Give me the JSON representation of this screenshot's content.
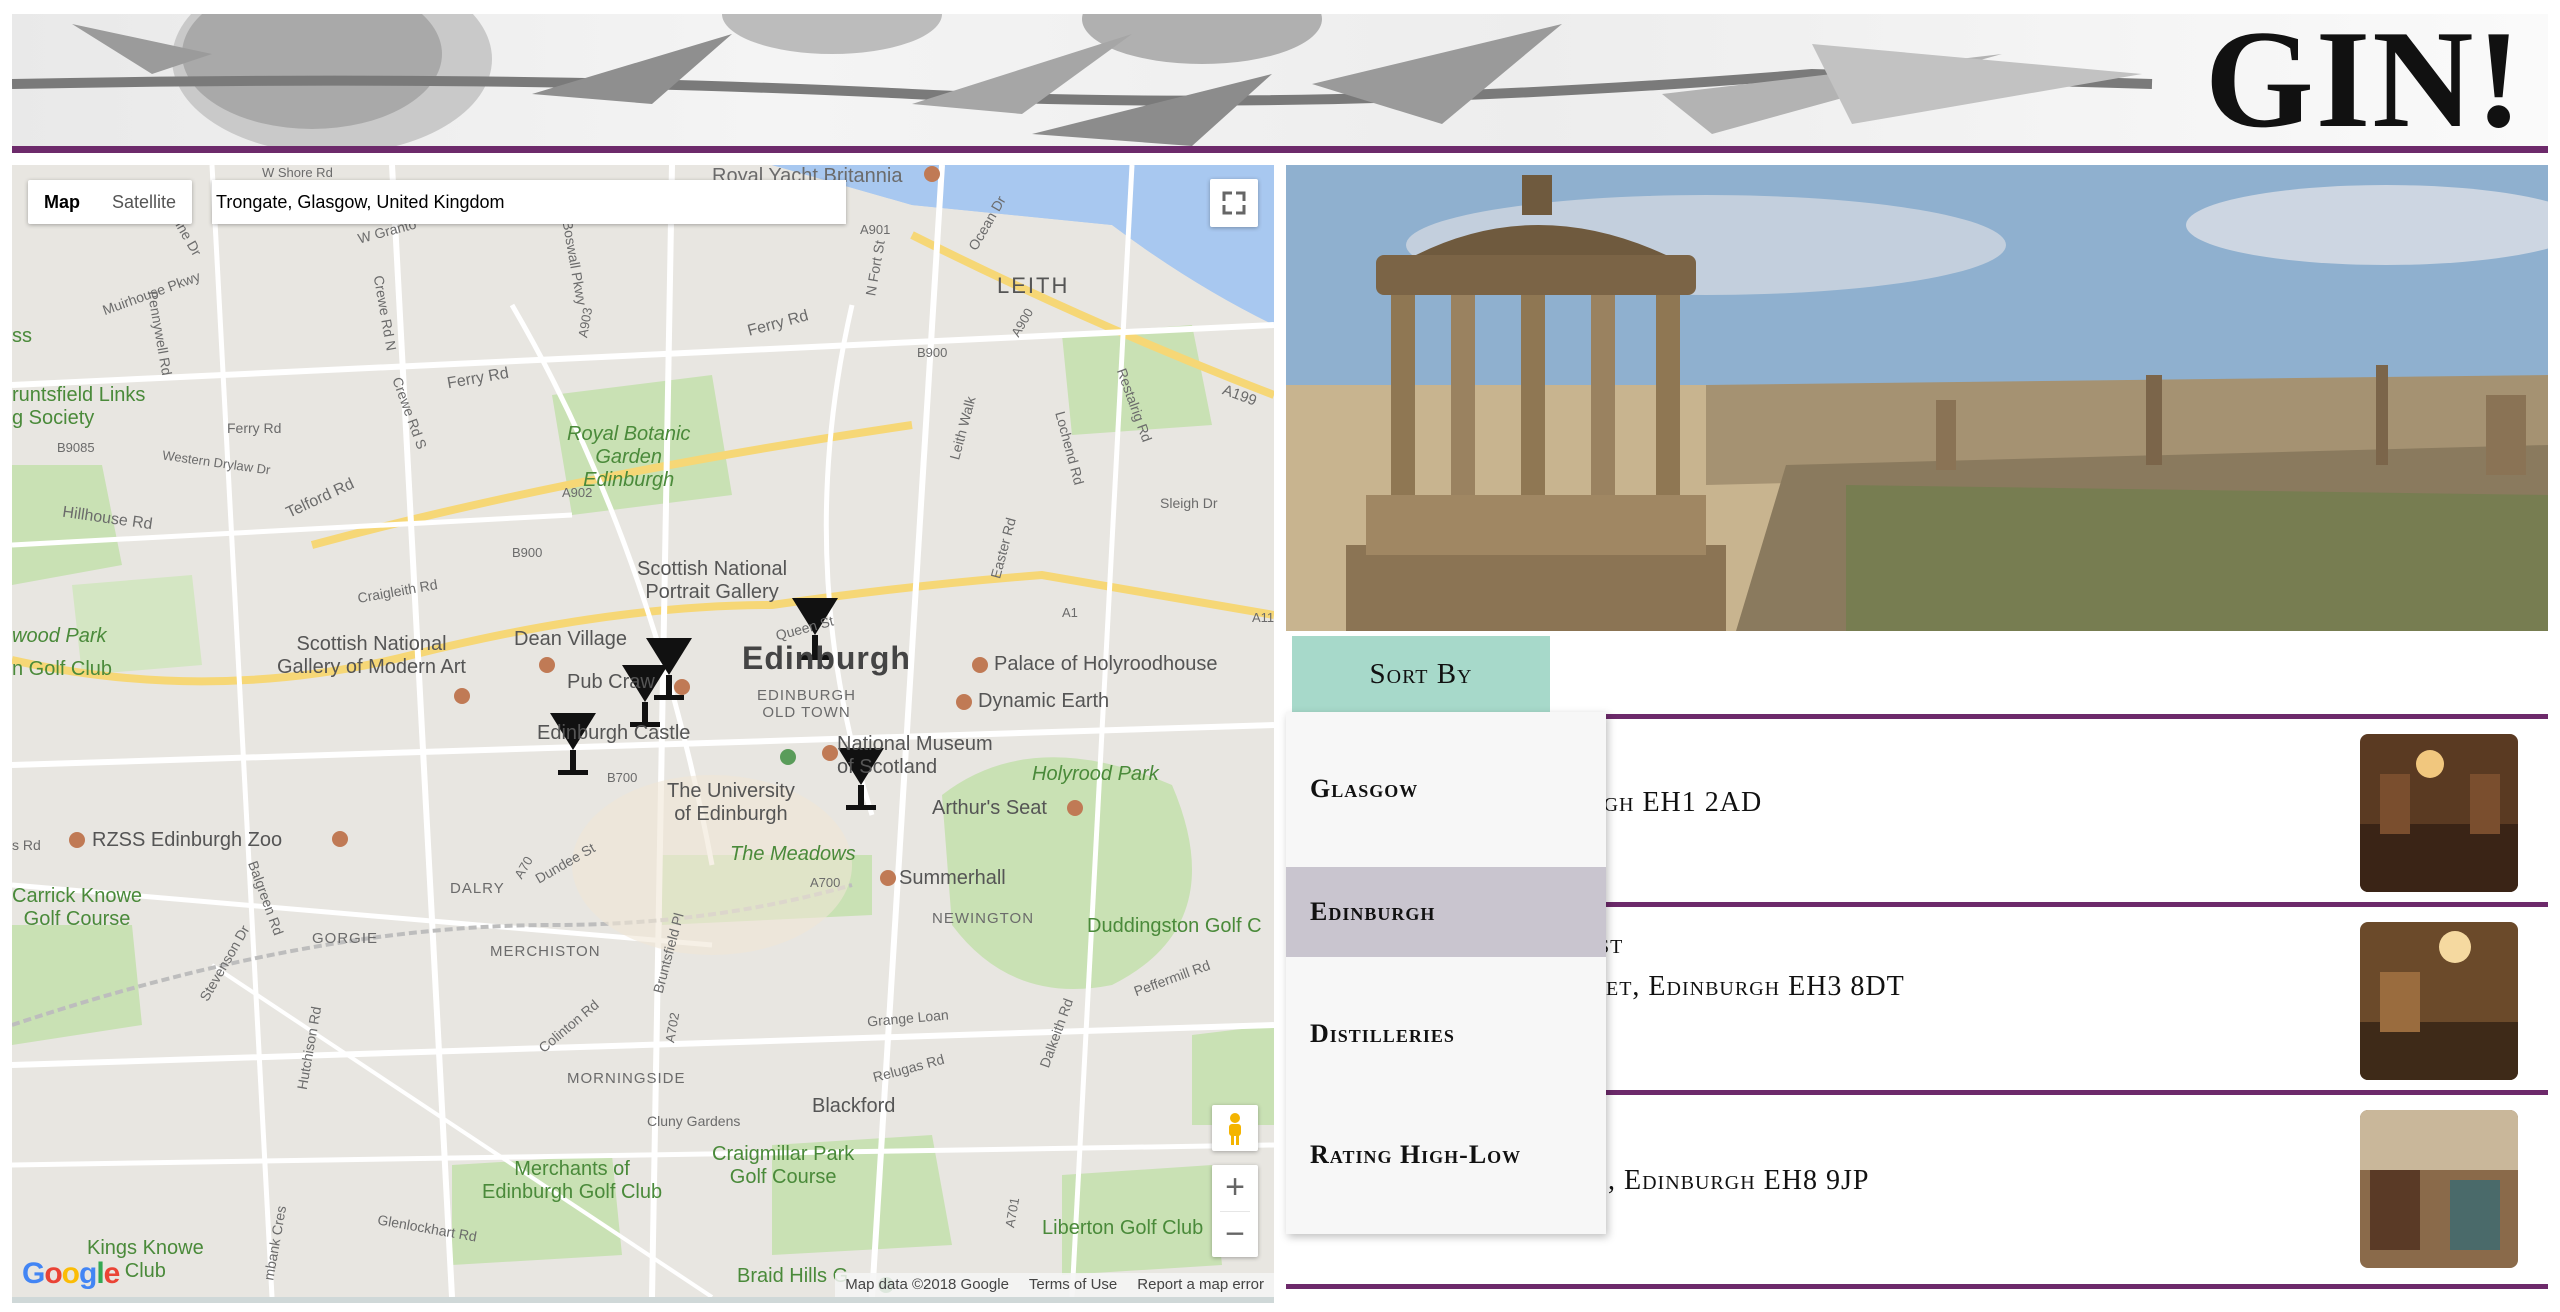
{
  "header": {
    "title": "GIN!"
  },
  "map": {
    "type_control": {
      "map_label": "Map",
      "satellite_label": "Satellite"
    },
    "search": {
      "value": "Trongate, Glasgow, United Kingdom"
    },
    "footer": {
      "attribution": "Map data ©2018 Google",
      "terms": "Terms of Use",
      "report": "Report a map error"
    },
    "logo": "Google",
    "zoom_in": "+",
    "zoom_out": "−",
    "labels": {
      "royal_yacht": "Royal Yacht Britannia",
      "w_shore": "W Shore Rd",
      "leith": "LEITH",
      "ferry_rd_1": "Ferry Rd",
      "ferry_rd_2": "Ferry Rd",
      "ferry_rd_3": "Ferry Rd",
      "telford": "Telford Rd",
      "hillhouse": "Hillhouse Rd",
      "royal_botanic": "Royal Botanic\nGarden\nEdinburgh",
      "fettes": "runtsfield Links\ng Society",
      "b9085": "B9085",
      "western": "Western Drylaw Dr",
      "scot_portrait": "Scottish National\nPortrait Gallery",
      "scot_modern": "Scottish National\nGallery of Modern Art",
      "dean": "Dean Village",
      "edinburgh": "Edinburgh",
      "pub_crawl": "Pub Craw",
      "edinburgh_castle": "Edinburgh Castle",
      "old_town": "EDINBURGH\nOLD TOWN",
      "palace": "Palace of Holyroodhouse",
      "dynamic": "Dynamic Earth",
      "museum": "National Museum\nof Scotland",
      "holyrood": "Holyrood Park",
      "arthurs": "Arthur's Seat",
      "university": "The University\nof Edinburgh",
      "meadows": "The Meadows",
      "summerhall": "Summerhall",
      "newington": "NEWINGTON",
      "zoo": "RZSS Edinburgh Zoo",
      "carrick": "Carrick Knowe\nGolf Course",
      "dalry": "DALRY",
      "gorgie": "GORGIE",
      "merchiston": "MERCHISTON",
      "duddingston": "Duddingston Golf C",
      "morningside": "MORNINGSIDE",
      "blackford": "Blackford",
      "craigmillar": "Craigmillar Park\nGolf Course",
      "merchants": "Merchants of\nEdinburgh Golf Club",
      "liberton": "Liberton Golf Club",
      "kings": "Kings Knowe\nClub",
      "braid": "Braid Hills G",
      "woodpark": "wood Park",
      "golfclub": "n Golf Club",
      "craigleith": "Craigleith Rd",
      "b900": "B900",
      "b700": "B700",
      "a700": "A700",
      "a70": "A70",
      "a1": "A1",
      "a199": "A199",
      "a901": "A901",
      "a902": "A902",
      "a903": "A903",
      "b901": "B900",
      "a900": "A900",
      "queen_st": "Queen St",
      "leith_walk": "Leith Walk",
      "lochend": "Lochend Rd",
      "restalrig": "Restalrig Rd",
      "easter": "Easter Rd",
      "sleigh": "Sleigh Dr",
      "dalkeith": "Dalkeith Rd",
      "pefermill": "Peffermill Rd",
      "grange": "Grange Loan",
      "relugas": "Relugas Rd",
      "colinton": "Colinton Rd",
      "glenlockhart": "Glenlockhart Rd",
      "balgreen": "Balgreen Rd",
      "stevenson": "Stevenson Dr",
      "dundee": "Dundee St",
      "bruntsfield": "Bruntsfield Pl",
      "hutchison": "Hutchison Rd",
      "cluny": "Cluny Gardens",
      "muirhouse": "Muirhouse Pkwy",
      "pennywell": "Pennywell Rd",
      "crewe_n": "Crewe Rd N",
      "crewe_s": "Crewe Rd S",
      "w_granton": "W Granto",
      "boswall": "Boswall Pkwy",
      "ocean": "Ocean Dr",
      "n_fort": "N Fort St",
      "a1140": "A11",
      "marine": "Marine Dr",
      "a702": "A702",
      "a701": "A701",
      "ss": "ss",
      "rd": "s Rd",
      "mbank": "mbank Cres"
    }
  },
  "sort": {
    "button_label": "Sort By",
    "options": [
      "Glasgow",
      "Edinburgh",
      "Distilleries",
      "Rating High-Low"
    ],
    "selected": "Edinburgh"
  },
  "listings": [
    {
      "address": "nburgh EH1 2AD"
    },
    {
      "name": "st",
      "address": "et, Edinburgh EH3 8DT"
    },
    {
      "address": ", Edinburgh EH8 9JP"
    }
  ],
  "colors": {
    "accent_purple": "#6d2a6b",
    "sort_button": "#a7d9ca",
    "selected_option": "#c9c5cf"
  }
}
